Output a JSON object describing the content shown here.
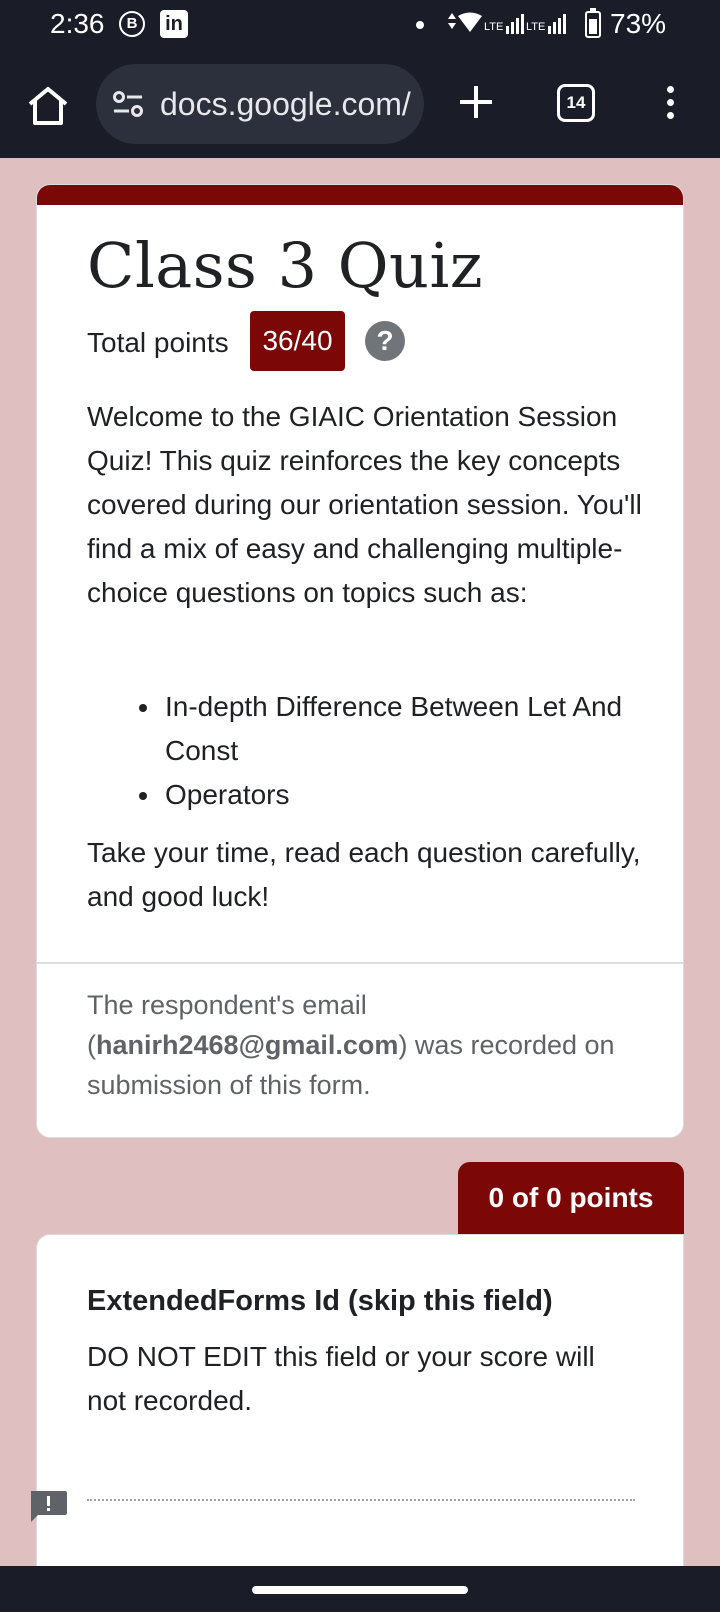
{
  "status_bar": {
    "time": "2:36",
    "b_icon_text": "B",
    "linkedin_text": "in",
    "network": "LTE",
    "battery": "73%"
  },
  "browser": {
    "url": "docs.google.com/",
    "tab_count": "14"
  },
  "header": {
    "title": "Class 3 Quiz",
    "total_points_label": "Total points",
    "score": "36/40",
    "help_symbol": "?",
    "description": "Welcome to the GIAIC Orientation Session Quiz! This quiz reinforces the key concepts covered during our orientation session. You'll find a mix of easy and challenging multiple-choice questions on topics such as:",
    "topics": [
      "In-depth Difference Between Let And Const",
      "Operators"
    ],
    "closing": "Take your time, read each question carefully, and good luck!",
    "email_prefix": "The respondent's email (",
    "email": "hanirh2468@gmail.com",
    "email_suffix": ") was recorded on submission of this form."
  },
  "question": {
    "points": "0 of 0 points",
    "title": "ExtendedForms Id (skip this field)",
    "description": "DO NOT EDIT this field or your score will not recorded."
  },
  "colors": {
    "theme": "#7b0707",
    "background": "#dfbfbf",
    "chrome": "#1a1d27"
  }
}
